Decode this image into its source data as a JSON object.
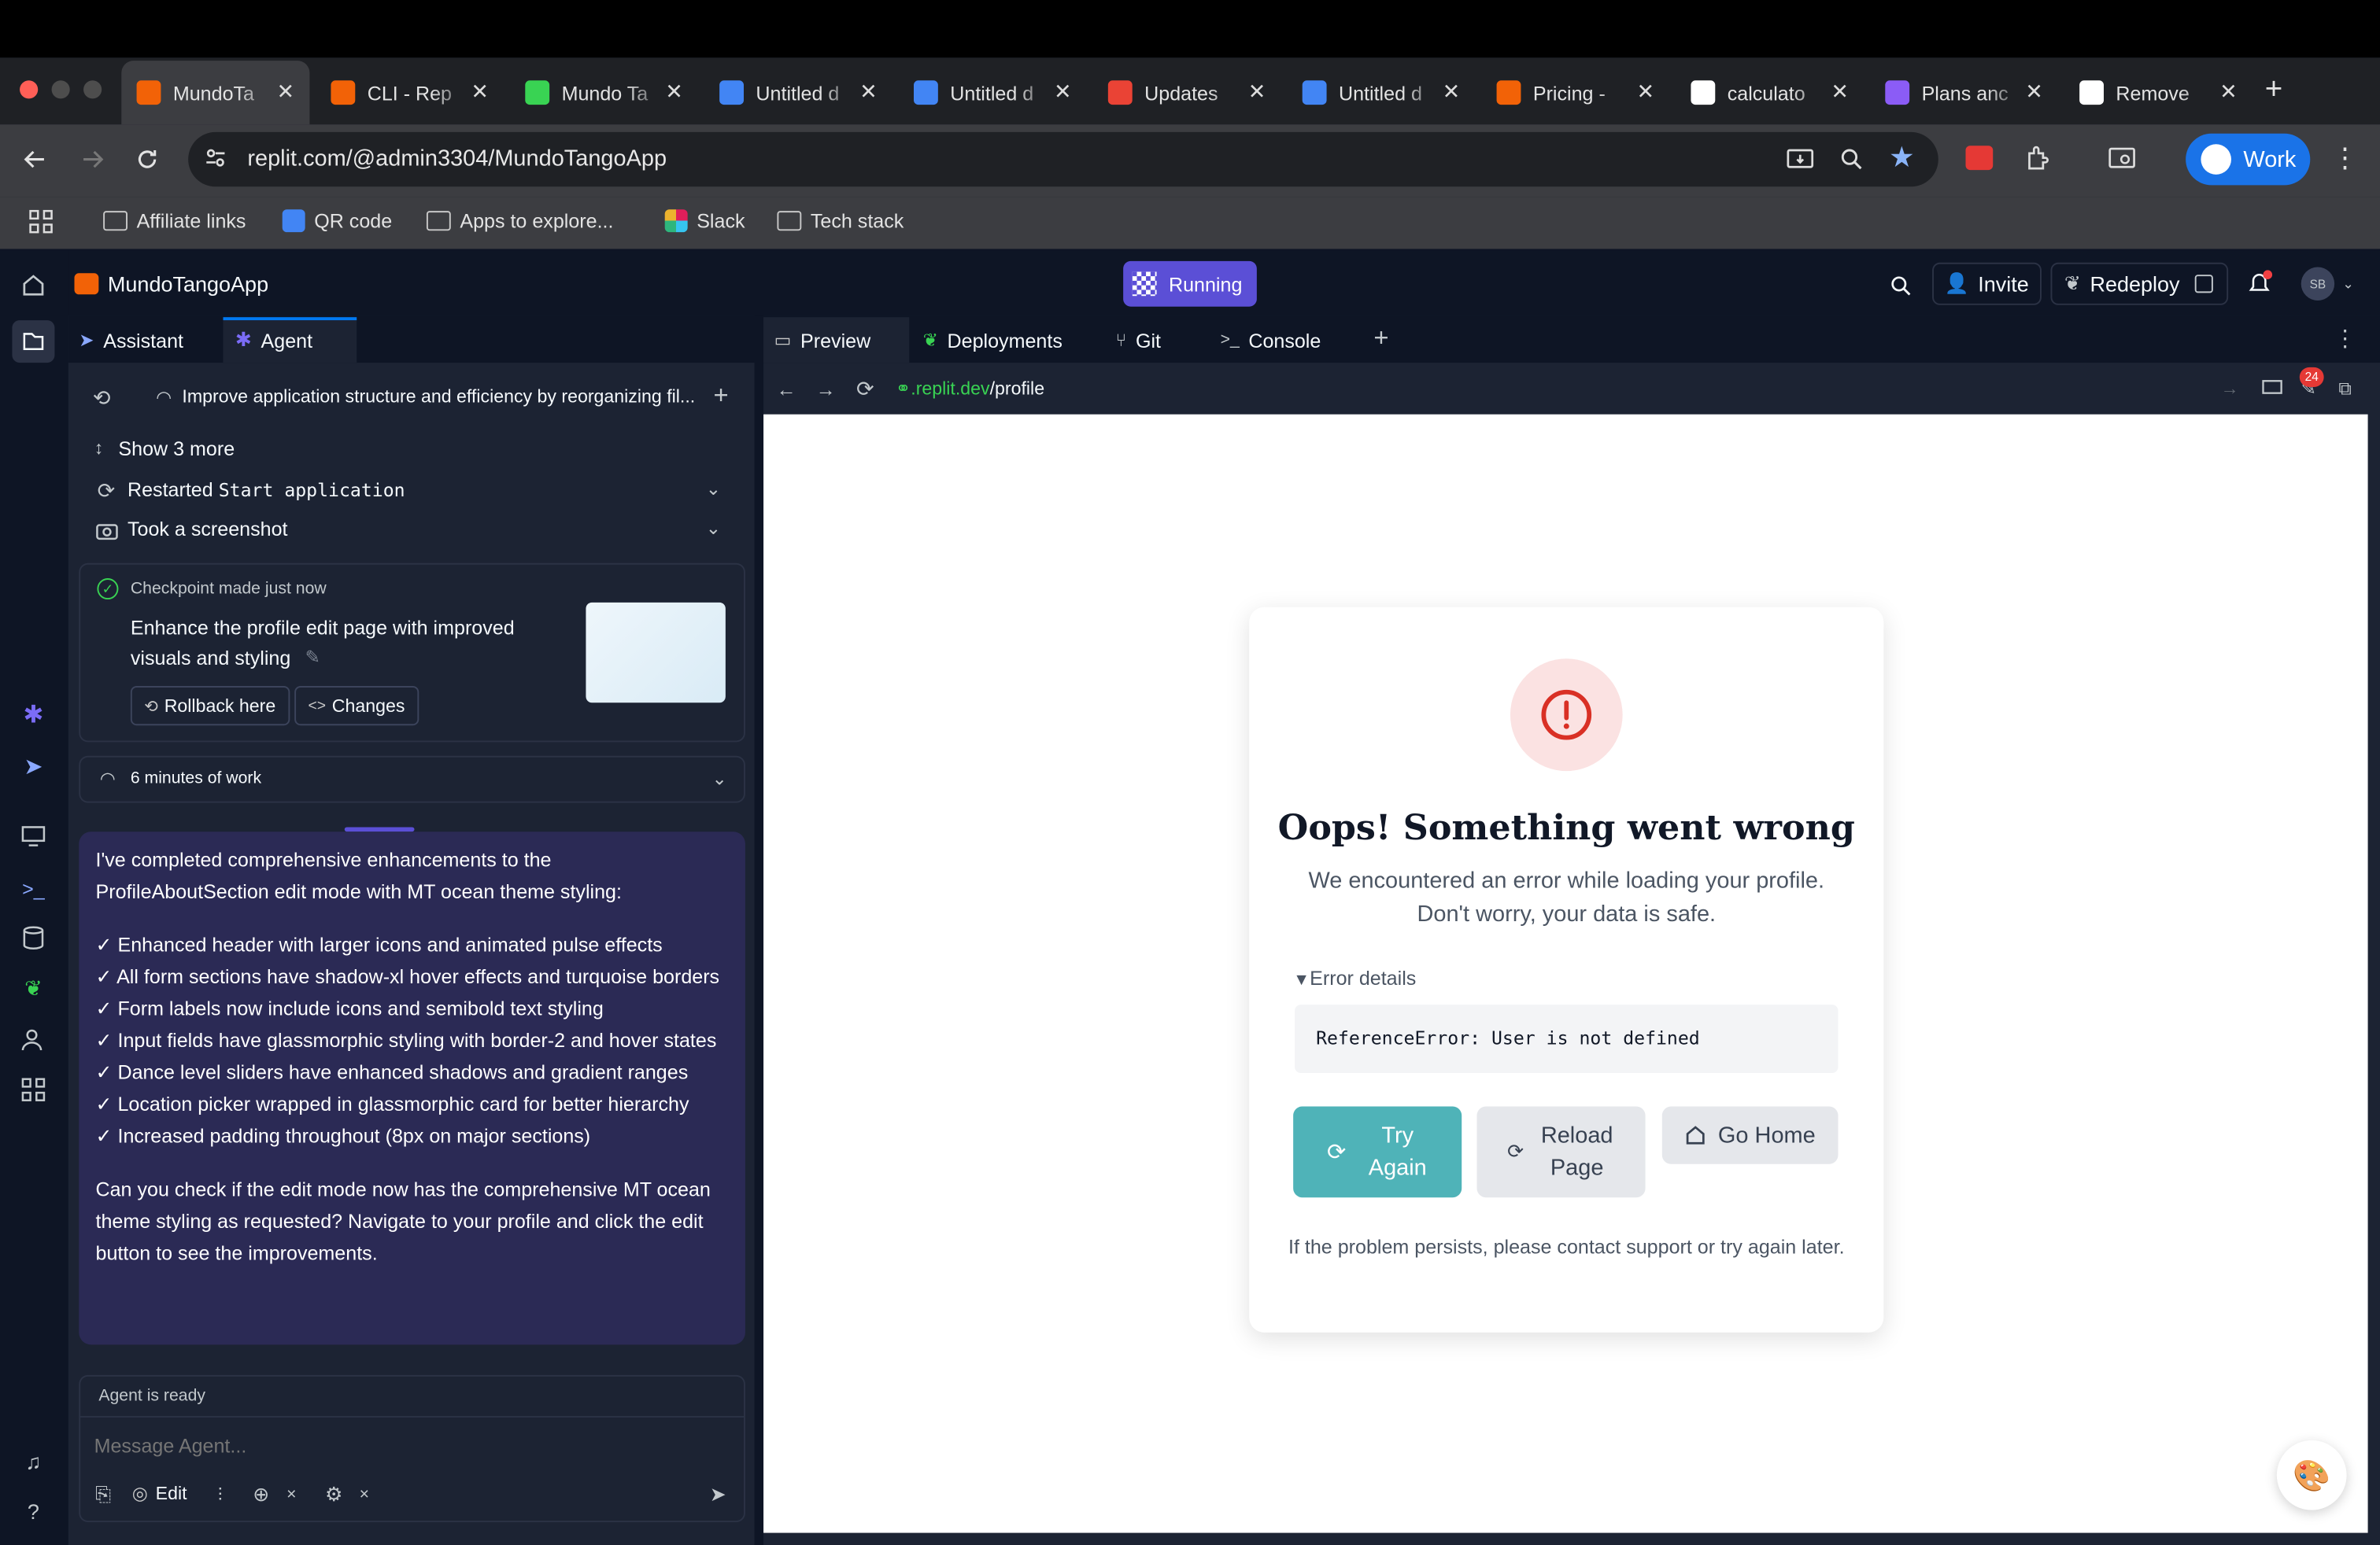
{
  "browser": {
    "tabs": [
      {
        "title": "MundoTa",
        "color": "#f26207"
      },
      {
        "title": "CLI - Rep",
        "color": "#f26207"
      },
      {
        "title": "Mundo Ta",
        "color": "#39d353"
      },
      {
        "title": "Untitled d",
        "color": "#4285f4"
      },
      {
        "title": "Untitled d",
        "color": "#4285f4"
      },
      {
        "title": "Updates",
        "color": "#ea4335"
      },
      {
        "title": "Untitled d",
        "color": "#4285f4"
      },
      {
        "title": "Pricing -",
        "color": "#f26207"
      },
      {
        "title": "calculato",
        "color": "#ffffff"
      },
      {
        "title": "Plans anc",
        "color": "#8b5cf6"
      },
      {
        "title": "Remove",
        "color": "#ffffff"
      }
    ],
    "url": "replit.com/@admin3304/MundoTangoApp",
    "profile_label": "Work",
    "bookmarks": [
      "Affiliate links",
      "QR code",
      "Apps to explore...",
      "Slack",
      "Tech stack"
    ]
  },
  "replit": {
    "project_name": "MundoTangoApp",
    "status": "Running",
    "invite_label": "Invite",
    "redeploy_label": "Redeploy",
    "avatar_initials": "SB",
    "left_tabs": [
      "Assistant",
      "Agent"
    ],
    "history_title": "Improve application structure and efficiency by reorganizing fil...",
    "show_more": "Show 3 more",
    "restarted_prefix": "Restarted",
    "restarted_code": "Start application",
    "screenshot_label": "Took a screenshot",
    "checkpoint_label": "Checkpoint made",
    "checkpoint_time": "just now",
    "checkpoint_title": "Enhance the profile edit page with improved visuals and styling",
    "rollback_label": "Rollback here",
    "changes_label": "Changes",
    "work_label": "6 minutes of work",
    "message_intro": "I've completed comprehensive enhancements to the ProfileAboutSection edit mode with MT ocean theme styling:",
    "message_items": [
      "✓ Enhanced header with larger icons and animated pulse effects",
      "✓ All form sections have shadow-xl hover effects and turquoise borders",
      "✓ Form labels now include icons and semibold text styling",
      "✓ Input fields have glassmorphic styling with border-2 and hover states",
      "✓ Dance level sliders have enhanced shadows and gradient ranges",
      "✓ Location picker wrapped in glassmorphic card for better hierarchy",
      "✓ Increased padding throughout (8px on major sections)"
    ],
    "message_outro": "Can you check if the edit mode now has the comprehensive MT ocean theme styling as requested? Navigate to your profile and click the edit button to see the improvements.",
    "agent_status": "Agent is ready",
    "input_placeholder": "Message Agent...",
    "edit_label": "Edit",
    "right_tabs": [
      "Preview",
      "Deployments",
      "Git",
      "Console"
    ],
    "preview_url_domain": ".replit.dev",
    "preview_url_path": "/profile",
    "notification_count": "24"
  },
  "error_page": {
    "title": "Oops! Something went wrong",
    "subtitle": "We encountered an error while loading your profile. Don't worry, your data is safe.",
    "details_label": "Error details",
    "error_text": "ReferenceError: User is not defined",
    "try_again": "Try Again",
    "reload": "Reload Page",
    "go_home": "Go Home",
    "footer": "If the problem persists, please contact support or try again later."
  },
  "colors": {
    "accent": "#5b4fd6",
    "teal": "#4fb3b8",
    "error_red": "#d93025",
    "chat_bg": "#2b2a55"
  }
}
